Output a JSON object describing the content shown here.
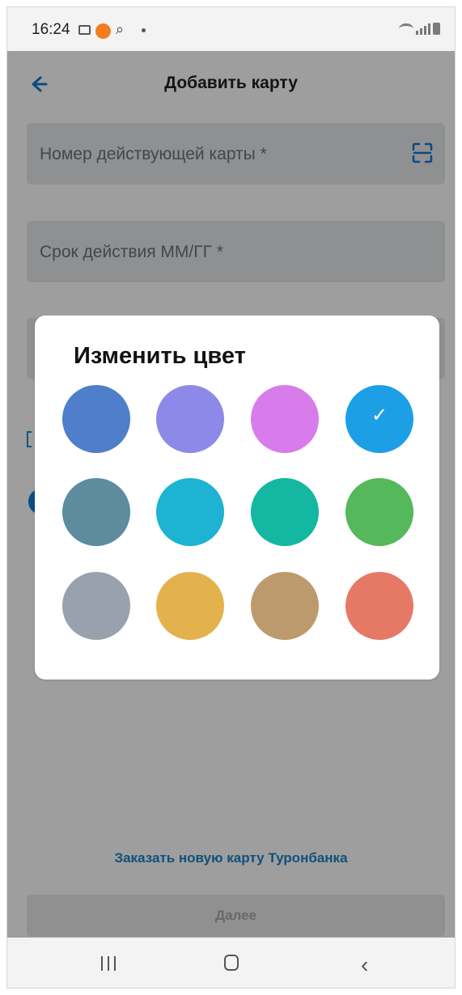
{
  "status_bar": {
    "time": "16:24"
  },
  "header": {
    "title": "Добавить карту"
  },
  "fields": {
    "card_number_placeholder": "Номер действующей карты *",
    "expiry_placeholder": "Срок действия ММ/ГГ *"
  },
  "dialog": {
    "title": "Изменить цвет",
    "swatches": [
      {
        "color": "#4f7ecb",
        "selected": false
      },
      {
        "color": "#8d89e8",
        "selected": false
      },
      {
        "color": "#d97ceb",
        "selected": false
      },
      {
        "color": "#1d9fe6",
        "selected": true,
        "check_mark": "✓"
      },
      {
        "color": "#5d8c9f",
        "selected": false
      },
      {
        "color": "#1db3d2",
        "selected": false
      },
      {
        "color": "#14b7a2",
        "selected": false
      },
      {
        "color": "#55b85b",
        "selected": false
      },
      {
        "color": "#98a1ad",
        "selected": false
      },
      {
        "color": "#e3b24c",
        "selected": false
      },
      {
        "color": "#bd9a6d",
        "selected": false
      },
      {
        "color": "#e67966",
        "selected": false
      }
    ]
  },
  "footer": {
    "order_link": "Заказать новую карту Туронбанка",
    "next_button": "Далее"
  },
  "icons": {
    "back": "arrow-left-icon",
    "scan": "scan-card-icon"
  },
  "accent_color": "#1a84c9"
}
